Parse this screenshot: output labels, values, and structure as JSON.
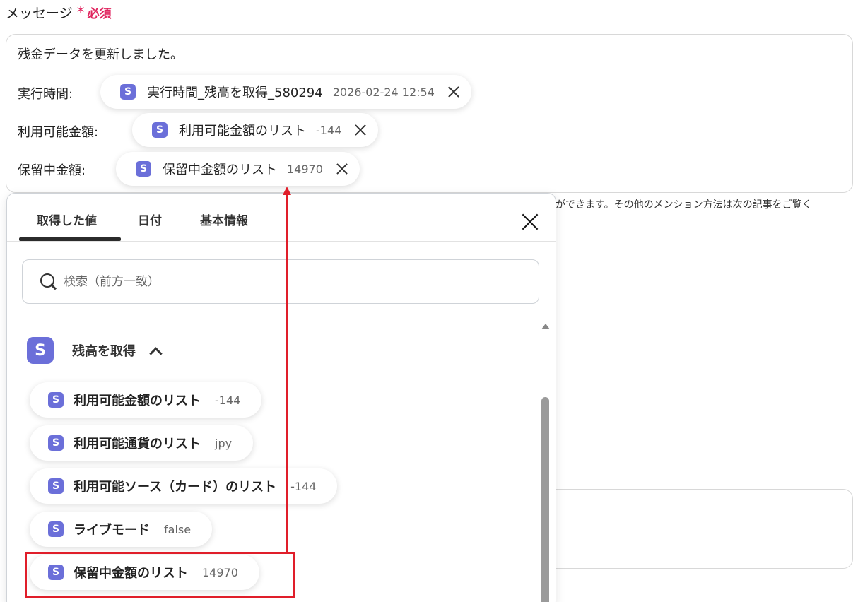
{
  "field": {
    "label": "メッセージ",
    "required_mark": "*",
    "required_text": "必須"
  },
  "message": {
    "line1": "残金データを更新しました。",
    "rows": [
      {
        "label": "実行時間:",
        "pill": {
          "icon": "S",
          "label": "実行時間_残高を取得_580294",
          "value": "2026-02-24 12:54"
        }
      },
      {
        "label": "利用可能金額:",
        "pill": {
          "icon": "S",
          "label": "利用可能金額のリスト",
          "value": "-144"
        }
      },
      {
        "label": "保留中金額:",
        "pill": {
          "icon": "S",
          "label": "保留中金額のリスト",
          "value": "14970"
        }
      }
    ]
  },
  "helper_text": "ができます。その他のメンション方法は次の記事をご覧く",
  "panel": {
    "tabs": [
      {
        "label": "取得した値",
        "active": true
      },
      {
        "label": "日付",
        "active": false
      },
      {
        "label": "基本情報",
        "active": false
      }
    ],
    "search": {
      "placeholder": "検索（前方一致）",
      "value": ""
    },
    "group": {
      "icon": "S",
      "title": "残高を取得",
      "expanded": true
    },
    "items": [
      {
        "icon": "S",
        "label": "利用可能金額のリスト",
        "value": "-144"
      },
      {
        "icon": "S",
        "label": "利用可能通貨のリスト",
        "value": "jpy"
      },
      {
        "icon": "S",
        "label": "利用可能ソース（カード）のリスト",
        "value": "-144"
      },
      {
        "icon": "S",
        "label": "ライブモード",
        "value": "false"
      },
      {
        "icon": "S",
        "label": "保留中金額のリスト",
        "value": "14970"
      }
    ]
  },
  "colors": {
    "accent": "#6b6fd9",
    "required": "#e0245e",
    "annotation": "#e01e2a"
  }
}
